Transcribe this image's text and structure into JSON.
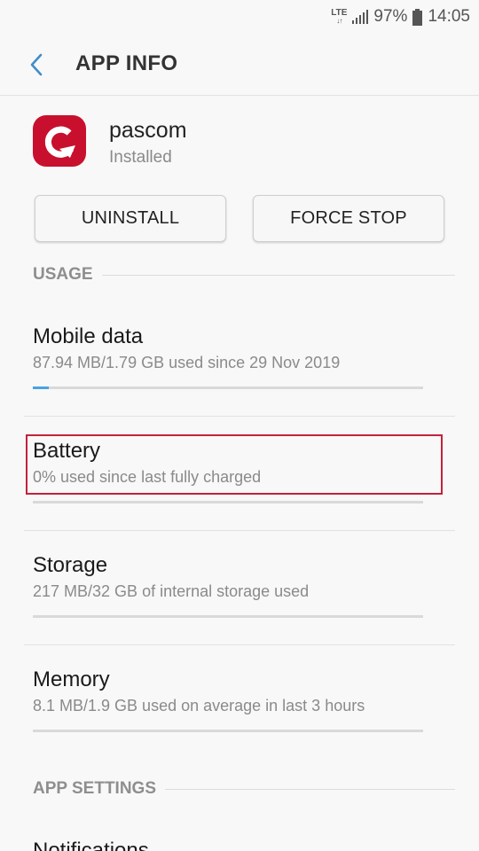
{
  "status_bar": {
    "network": "LTE",
    "battery_percent": "97%",
    "time": "14:05",
    "icons": [
      "lte-icon",
      "signal-icon",
      "battery-icon"
    ]
  },
  "header": {
    "title": "APP INFO",
    "back_icon": "back-arrow-icon",
    "accent_color": "#3d8ec9"
  },
  "app": {
    "name": "pascom",
    "status": "Installed",
    "icon": "pascom-logo-icon",
    "brand_color": "#c8102e"
  },
  "buttons": {
    "uninstall": "UNINSTALL",
    "force_stop": "FORCE STOP"
  },
  "sections": {
    "usage": "USAGE",
    "app_settings": "APP SETTINGS"
  },
  "usage_items": [
    {
      "title": "Mobile data",
      "subtitle": "87.94 MB/1.79 GB used since 29 Nov 2019",
      "progress_fraction": 0.04
    },
    {
      "title": "Battery",
      "subtitle": "0% used since last fully charged",
      "progress_fraction": 0.0,
      "highlighted": true,
      "highlight_color": "#c2223c"
    },
    {
      "title": "Storage",
      "subtitle": "217 MB/32 GB of internal storage used",
      "progress_fraction": 0.0
    },
    {
      "title": "Memory",
      "subtitle": "8.1 MB/1.9 GB used on average in last 3 hours",
      "progress_fraction": 0.0
    }
  ],
  "settings_items": [
    {
      "title": "Notifications"
    }
  ]
}
